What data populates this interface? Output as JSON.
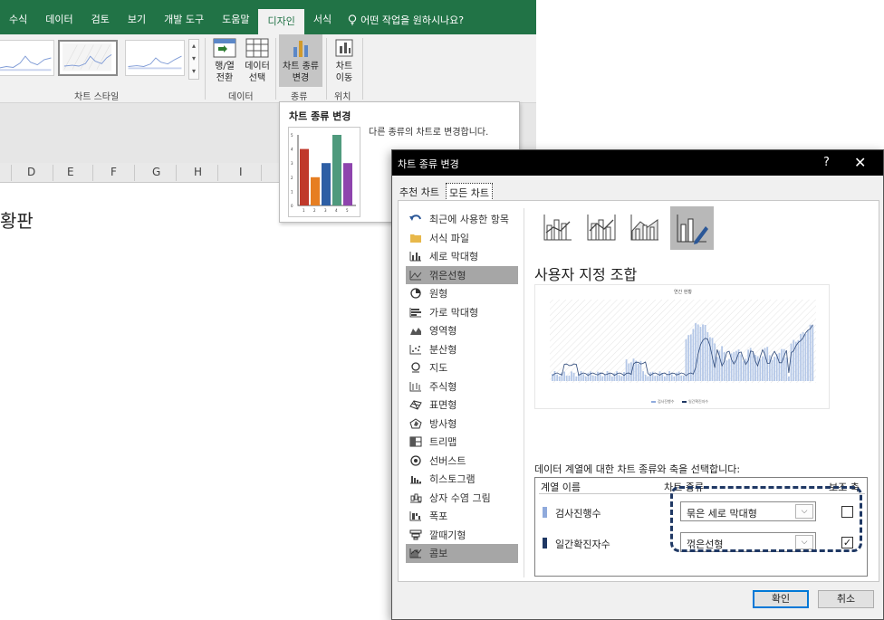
{
  "ribbon": {
    "tabs": [
      "수식",
      "데이터",
      "검토",
      "보기",
      "개발 도구",
      "도움말",
      "디자인",
      "서식"
    ],
    "active_tab": "디자인",
    "tell_me": "어떤 작업을 원하시나요?",
    "groups": {
      "chart_styles": "차트 스타일",
      "data": "데이터",
      "type": "종류",
      "location": "위치"
    },
    "buttons": {
      "switch_row_col_1": "행/열",
      "switch_row_col_2": "전환",
      "select_data_1": "데이터",
      "select_data_2": "선택",
      "change_type_1": "차트 종류",
      "change_type_2": "변경",
      "move_chart_1": "차트",
      "move_chart_2": "이동"
    }
  },
  "columns": [
    "D",
    "E",
    "F",
    "G",
    "H",
    "I"
  ],
  "sheet_text": "황판",
  "tooltip": {
    "title": "차트 종류 변경",
    "description": "다른 종류의 차트로 변경합니다.",
    "sample": {
      "y_ticks": [
        "0",
        "1",
        "2",
        "3",
        "4",
        "5"
      ],
      "x_ticks": [
        "1",
        "2",
        "3",
        "4",
        "5"
      ],
      "values": [
        4,
        2,
        3,
        5,
        3
      ],
      "colors": [
        "#c0392b",
        "#e67e22",
        "#2e5fa5",
        "#4f9a7d",
        "#8e44ad"
      ]
    }
  },
  "dialog": {
    "title": "차트 종류 변경",
    "help": "?",
    "close": "✕",
    "tabs": [
      "추천 차트",
      "모든 차트"
    ],
    "active_tab": "모든 차트",
    "chart_types": [
      "최근에 사용한 항목",
      "서식 파일",
      "세로 막대형",
      "꺾은선형",
      "원형",
      "가로 막대형",
      "영역형",
      "분산형",
      "지도",
      "주식형",
      "표면형",
      "방사형",
      "트리맵",
      "선버스트",
      "히스토그램",
      "상자 수염 그림",
      "폭포",
      "깔때기형",
      "콤보"
    ],
    "highlighted_types": [
      "꺾은선형",
      "콤보"
    ],
    "combo_title": "사용자 지정 조합",
    "preview_title": "연간 현황",
    "preview_legend": [
      "검사진행수",
      "일간확진자수"
    ],
    "series_intro": "데이터 계열에 대한 차트 종류와 축을 선택합니다:",
    "table_headers": {
      "name": "계열 이름",
      "type": "차트 종류",
      "secondary": "보조 축"
    },
    "series": [
      {
        "name": "검사진행수",
        "type": "묶은 세로 막대형",
        "secondary": false,
        "color": "#8faadc"
      },
      {
        "name": "일간확진자수",
        "type": "꺾은선형",
        "secondary": true,
        "color": "#1f3864"
      }
    ],
    "ok": "확인",
    "cancel": "취소"
  }
}
